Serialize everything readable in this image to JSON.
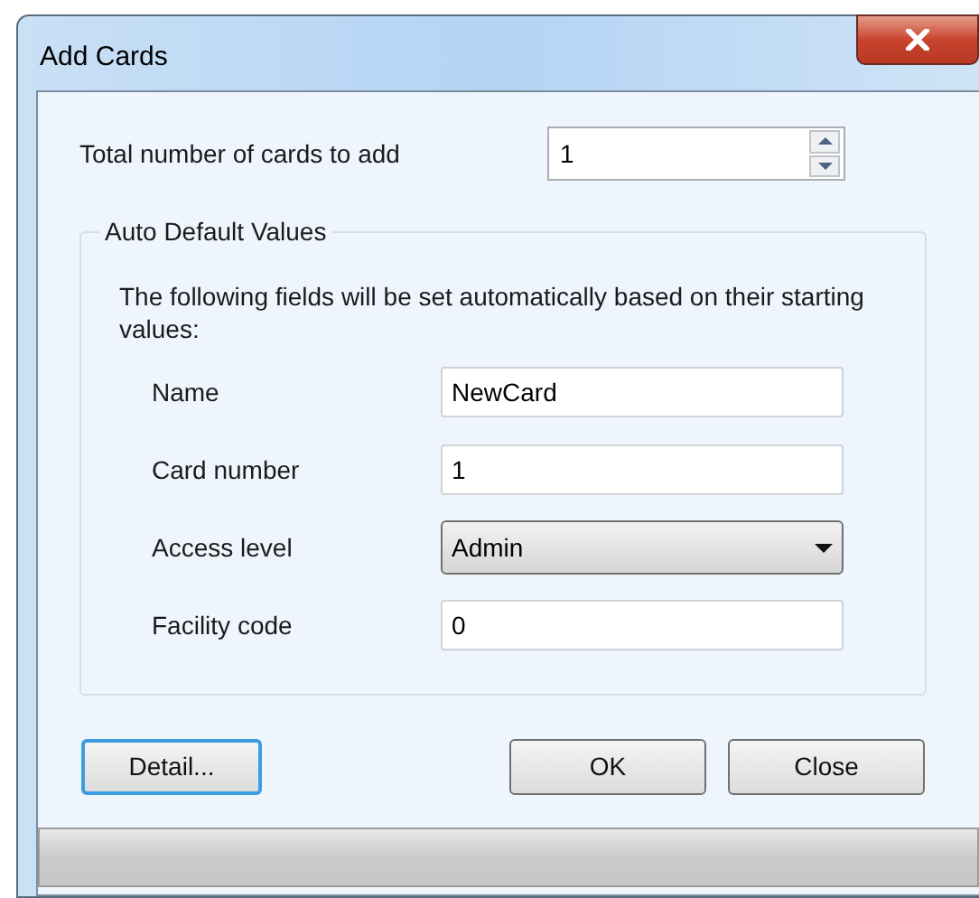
{
  "window": {
    "title": "Add Cards"
  },
  "total": {
    "label": "Total number of cards to add",
    "value": "1"
  },
  "group": {
    "title": "Auto Default Values",
    "description": "The following fields will be set automatically based on their starting values:",
    "fields": [
      {
        "kind": "text",
        "label": "Name",
        "value": "NewCard"
      },
      {
        "kind": "text",
        "label": "Card number",
        "value": "1"
      },
      {
        "kind": "dropdown",
        "label": "Access level",
        "value": "Admin"
      },
      {
        "kind": "text",
        "label": "Facility code",
        "value": "0"
      }
    ]
  },
  "buttons": [
    {
      "label": "Detail...",
      "focused": true
    },
    {
      "label": "OK",
      "focused": false
    },
    {
      "label": "Close",
      "focused": false
    }
  ]
}
